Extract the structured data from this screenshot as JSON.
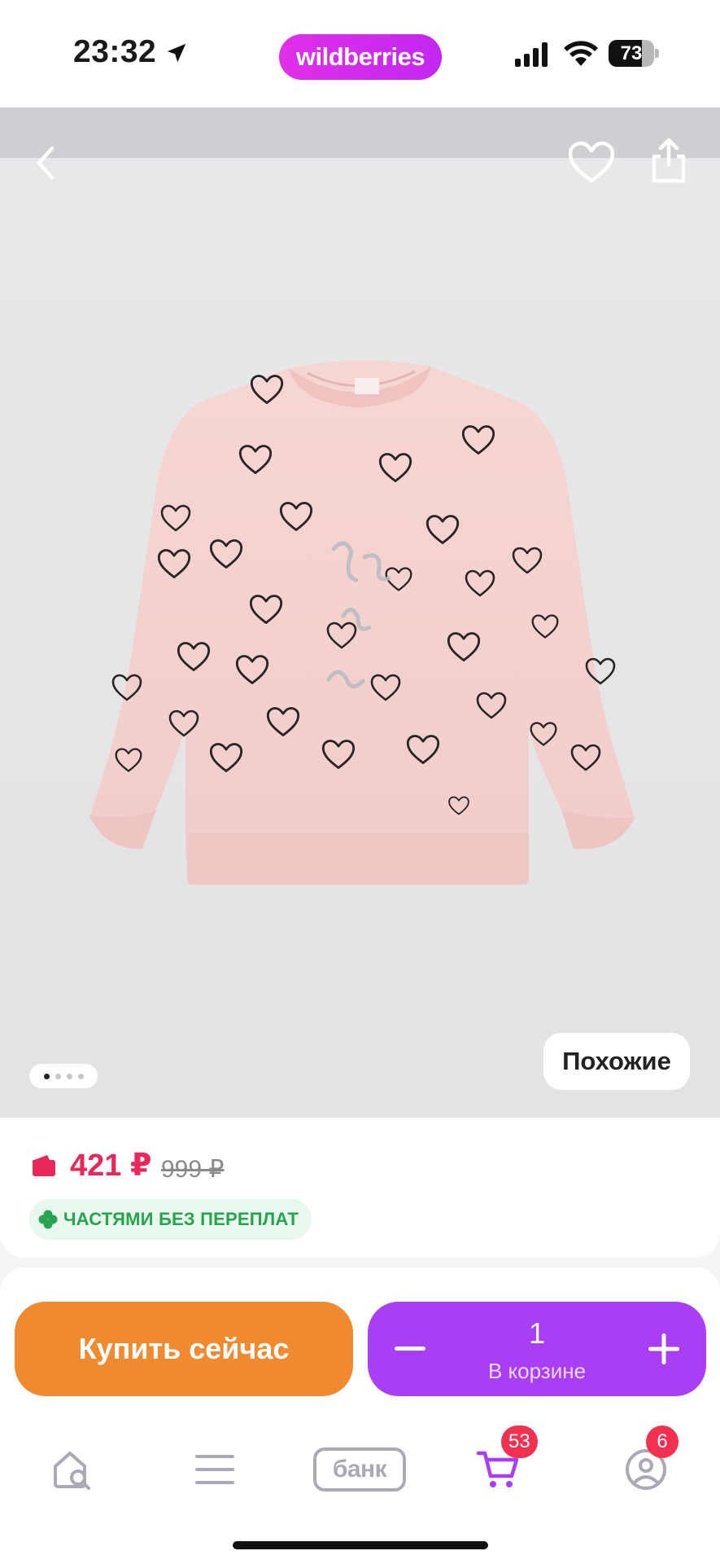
{
  "status_bar": {
    "time": "23:32",
    "brand": "wildberries",
    "battery_level": "73",
    "battery_fraction": 0.73
  },
  "gallery": {
    "image_index": 1,
    "image_count": 4,
    "similar_label": "Похожие",
    "icons": [
      "back-icon",
      "heart-icon",
      "share-icon"
    ]
  },
  "price": {
    "current": "421 ₽",
    "old": "999 ₽",
    "installment_label": "ЧАСТЯМИ БЕЗ ПЕРЕПЛАТ",
    "colors": {
      "price": "#e8285a",
      "installment": "#28a350"
    }
  },
  "actions": {
    "buy_now": "Купить сейчас",
    "quantity": "1",
    "in_cart_label": "В корзине",
    "colors": {
      "buy": "#ef8a30",
      "cart": "#a93ef5"
    }
  },
  "tabbar": {
    "bank_label": "банк",
    "cart_badge": "53",
    "profile_badge": "6",
    "icons": [
      "home-search-icon",
      "menu-icon",
      "bank-icon",
      "cart-icon",
      "profile-icon"
    ]
  }
}
